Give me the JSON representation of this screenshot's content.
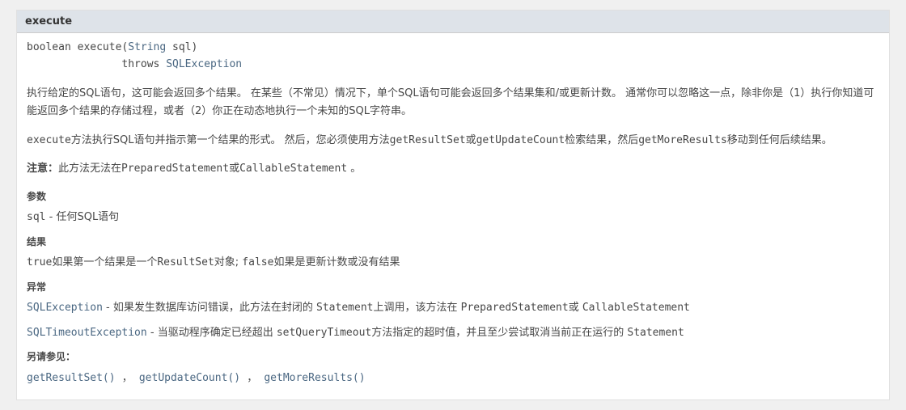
{
  "header": {
    "title": "execute"
  },
  "signature": {
    "return_type": "boolean",
    "method_name": "execute",
    "param_open": "(",
    "param_type": "String",
    "param_name": " sql",
    "param_close": ")",
    "throws_indent": "               throws ",
    "throws_type": "SQLException"
  },
  "description": {
    "para1": "执行给定的SQL语句，这可能会返回多个结果。 在某些（不常见）情况下，单个SQL语句可能会返回多个结果集和/或更新计数。 通常你可以忽略这一点，除非你是（1）执行你知道可能返回多个结果的存储过程，或者（2）你正在动态地执行一个未知的SQL字符串。",
    "para2_a": "execute",
    "para2_b": "方法执行SQL语句并指示第一个结果的形式。 然后，您必须使用方法",
    "para2_c": "getResultSet",
    "para2_d": "或",
    "para2_e": "getUpdateCount",
    "para2_f": "检索结果，然后",
    "para2_g": "getMoreResults",
    "para2_h": "移动到任何后续结果。"
  },
  "note": {
    "label": "注意：",
    "text_a": "此方法无法在",
    "code1": "PreparedStatement",
    "text_b": "或",
    "code2": "CallableStatement",
    "text_c": " 。"
  },
  "params": {
    "label": "参数",
    "name": "sql",
    "sep": " - ",
    "desc": "任何SQL语句"
  },
  "returns": {
    "label": "结果",
    "val_a": "true",
    "text_a": "如果第一个结果是一个",
    "code_a": "ResultSet",
    "text_b": "对象; ",
    "val_b": "false",
    "text_c": "如果是更新计数或没有结果"
  },
  "throws": {
    "label": "异常",
    "items": [
      {
        "type": "SQLException",
        "sep": " - ",
        "desc_a": "如果发生数据库访问错误，此方法在封闭的 ",
        "code_a": "Statement",
        "desc_b": "上调用，该方法在 ",
        "code_b": "PreparedStatement",
        "desc_c": "或 ",
        "code_c": "CallableStatement"
      },
      {
        "type": "SQLTimeoutException",
        "sep": " - ",
        "desc_a": "当驱动程序确定已经超出 ",
        "code_a": "setQueryTimeout",
        "desc_b": "方法指定的超时值，并且至少尝试取消当前正在运行的 ",
        "code_b": "Statement",
        "desc_c": "",
        "code_c": ""
      }
    ]
  },
  "see_also": {
    "label": "另请参见：",
    "links": [
      "getResultSet()",
      "getUpdateCount()",
      "getMoreResults()"
    ],
    "comma": " ， "
  }
}
